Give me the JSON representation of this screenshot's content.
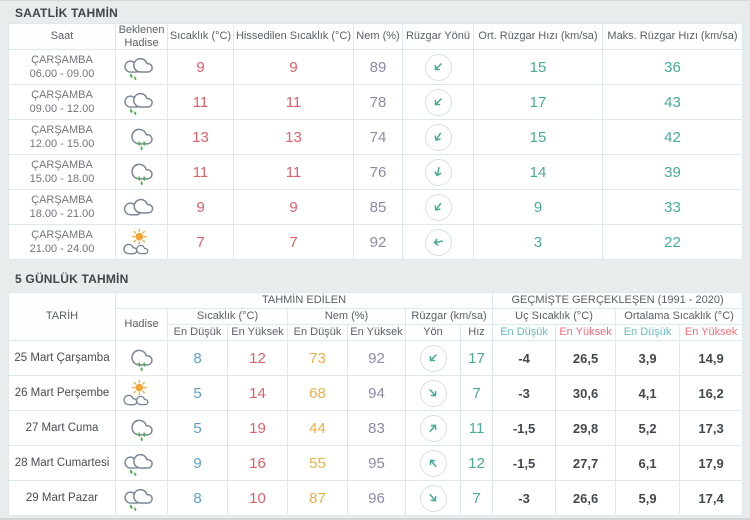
{
  "colors": {
    "accent_red": "#dd5f68",
    "accent_blue": "#5b9fc9",
    "accent_orange": "#e9b04c",
    "accent_purple": "#8f89a8",
    "accent_teal": "#47ab96",
    "past_low_teal": "#66bcc2",
    "past_high_pink": "#ef707b",
    "drop_green": "#54b054",
    "sun_orange": "#f2a63b",
    "sun_ray": "#eeb44d",
    "cloud_gray": "#7d8695"
  },
  "hourly": {
    "title": "SAATLİK TAHMİN",
    "columns": [
      "Saat",
      "Beklenen Hadise",
      "Sıcaklık (°C)",
      "Hissedilen Sıcaklık (°C)",
      "Nem (%)",
      "Rüzgar Yönü",
      "Ort. Rüzgar Hızı (km/sa)",
      "Maks. Rüzgar Hızı (km/sa)"
    ],
    "rows": [
      {
        "day": "ÇARŞAMBA",
        "time": "06.00 - 09.00",
        "icon": "clouds-rain",
        "temperature": "9",
        "feels_like": "9",
        "humidity": "89",
        "wind_dir_deg": 225,
        "avg_wind": "15",
        "max_wind": "36"
      },
      {
        "day": "ÇARŞAMBA",
        "time": "09.00 - 12.00",
        "icon": "clouds-rain",
        "temperature": "11",
        "feels_like": "11",
        "humidity": "78",
        "wind_dir_deg": 225,
        "avg_wind": "17",
        "max_wind": "43"
      },
      {
        "day": "ÇARŞAMBA",
        "time": "12.00 - 15.00",
        "icon": "rain",
        "temperature": "13",
        "feels_like": "13",
        "humidity": "74",
        "wind_dir_deg": 213,
        "avg_wind": "15",
        "max_wind": "42"
      },
      {
        "day": "ÇARŞAMBA",
        "time": "15.00 - 18.00",
        "icon": "rain",
        "temperature": "11",
        "feels_like": "11",
        "humidity": "76",
        "wind_dir_deg": 192,
        "avg_wind": "14",
        "max_wind": "39"
      },
      {
        "day": "ÇARŞAMBA",
        "time": "18.00 - 21.00",
        "icon": "clouds",
        "temperature": "9",
        "feels_like": "9",
        "humidity": "85",
        "wind_dir_deg": 215,
        "avg_wind": "9",
        "max_wind": "33"
      },
      {
        "day": "ÇARŞAMBA",
        "time": "21.00 - 24.00",
        "icon": "sun-clouds",
        "temperature": "7",
        "feels_like": "7",
        "humidity": "92",
        "wind_dir_deg": 258,
        "avg_wind": "3",
        "max_wind": "22"
      }
    ]
  },
  "daily": {
    "title": "5 GÜNLÜK TAHMİN",
    "header": {
      "date": "TARİH",
      "event": "Hadise",
      "predicted": "TAHMİN EDİLEN",
      "past": "GEÇMİŞTE GERÇEKLEŞEN (1991 - 2020)",
      "temp": "Sıcaklık (°C)",
      "humidity": "Nem (%)",
      "wind": "Rüzgar (km/sa)",
      "extreme_temp": "Uç Sıcaklık (°C)",
      "avg_temp": "Ortalama Sıcaklık (°C)",
      "low": "En Düşük",
      "high": "En Yüksek",
      "dir": "Yön",
      "speed": "Hız"
    },
    "rows": [
      {
        "date": "25 Mart Çarşamba",
        "icon": "rain",
        "temp_low": "8",
        "temp_high": "12",
        "hum_low": "73",
        "hum_high": "92",
        "wind_dir_deg": 225,
        "wind_speed": "17",
        "ext_low": "-4",
        "ext_high": "26,5",
        "avg_low": "3,9",
        "avg_high": "14,9"
      },
      {
        "date": "26 Mart Perşembe",
        "icon": "sun-clouds",
        "temp_low": "5",
        "temp_high": "14",
        "hum_low": "68",
        "hum_high": "94",
        "wind_dir_deg": 137,
        "wind_speed": "7",
        "ext_low": "-3",
        "ext_high": "30,6",
        "avg_low": "4,1",
        "avg_high": "16,2"
      },
      {
        "date": "27 Mart Cuma",
        "icon": "rain",
        "temp_low": "5",
        "temp_high": "19",
        "hum_low": "44",
        "hum_high": "83",
        "wind_dir_deg": 40,
        "wind_speed": "11",
        "ext_low": "-1,5",
        "ext_high": "29,8",
        "avg_low": "5,2",
        "avg_high": "17,3"
      },
      {
        "date": "28 Mart Cumartesi",
        "icon": "clouds-rain",
        "temp_low": "9",
        "temp_high": "16",
        "hum_low": "55",
        "hum_high": "95",
        "wind_dir_deg": 320,
        "wind_speed": "12",
        "ext_low": "-1,5",
        "ext_high": "27,7",
        "avg_low": "6,1",
        "avg_high": "17,9"
      },
      {
        "date": "29 Mart Pazar",
        "icon": "clouds-rain",
        "temp_low": "8",
        "temp_high": "10",
        "hum_low": "87",
        "hum_high": "96",
        "wind_dir_deg": 140,
        "wind_speed": "7",
        "ext_low": "-3",
        "ext_high": "26,6",
        "avg_low": "5,9",
        "avg_high": "17,4"
      }
    ]
  }
}
